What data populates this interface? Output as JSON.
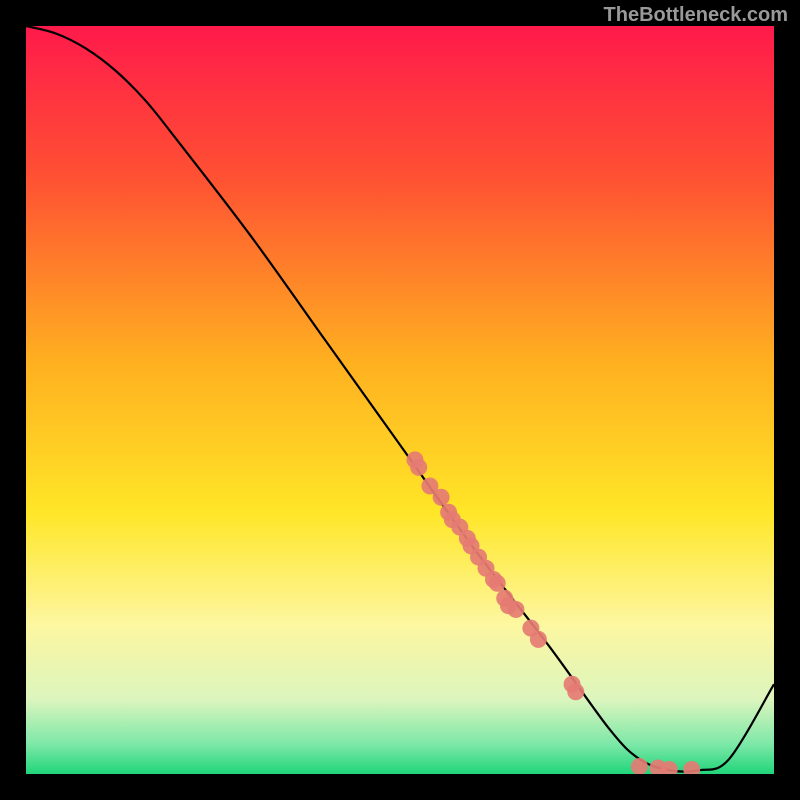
{
  "attribution": "TheBottleneck.com",
  "chart_data": {
    "type": "line",
    "title": "",
    "xlabel": "",
    "ylabel": "",
    "xlim": [
      0,
      100
    ],
    "ylim": [
      0,
      100
    ],
    "curve": {
      "name": "bottleneck-curve",
      "x": [
        0,
        4,
        8,
        12,
        16,
        20,
        30,
        40,
        50,
        60,
        70,
        78,
        82,
        86,
        90,
        94,
        100
      ],
      "y": [
        100,
        99,
        97,
        94,
        90,
        85,
        72,
        58,
        44,
        30,
        17,
        6,
        2,
        0.5,
        0.5,
        2,
        12
      ]
    },
    "scatter": {
      "name": "data-points",
      "color": "#e57b73",
      "points": [
        {
          "x": 52.0,
          "y": 42.0
        },
        {
          "x": 52.5,
          "y": 41.0
        },
        {
          "x": 54.0,
          "y": 38.5
        },
        {
          "x": 55.5,
          "y": 37.0
        },
        {
          "x": 56.5,
          "y": 35.0
        },
        {
          "x": 57.0,
          "y": 34.0
        },
        {
          "x": 58.0,
          "y": 33.0
        },
        {
          "x": 59.0,
          "y": 31.5
        },
        {
          "x": 59.5,
          "y": 30.5
        },
        {
          "x": 60.5,
          "y": 29.0
        },
        {
          "x": 61.5,
          "y": 27.5
        },
        {
          "x": 62.5,
          "y": 26.0
        },
        {
          "x": 63.0,
          "y": 25.5
        },
        {
          "x": 64.0,
          "y": 23.5
        },
        {
          "x": 64.5,
          "y": 22.5
        },
        {
          "x": 65.5,
          "y": 22.0
        },
        {
          "x": 67.5,
          "y": 19.5
        },
        {
          "x": 68.5,
          "y": 18.0
        },
        {
          "x": 73.0,
          "y": 12.0
        },
        {
          "x": 73.5,
          "y": 11.0
        },
        {
          "x": 82.0,
          "y": 1.0
        },
        {
          "x": 84.5,
          "y": 0.8
        },
        {
          "x": 86.0,
          "y": 0.6
        },
        {
          "x": 89.0,
          "y": 0.6
        }
      ]
    },
    "gradient_stops": [
      {
        "offset": 0.0,
        "color": "#ff1a4b"
      },
      {
        "offset": 0.2,
        "color": "#ff5033"
      },
      {
        "offset": 0.45,
        "color": "#ffb020"
      },
      {
        "offset": 0.65,
        "color": "#ffe627"
      },
      {
        "offset": 0.8,
        "color": "#fdf7a0"
      },
      {
        "offset": 0.9,
        "color": "#dcf5bd"
      },
      {
        "offset": 0.96,
        "color": "#7de8a8"
      },
      {
        "offset": 1.0,
        "color": "#20d57a"
      }
    ]
  }
}
